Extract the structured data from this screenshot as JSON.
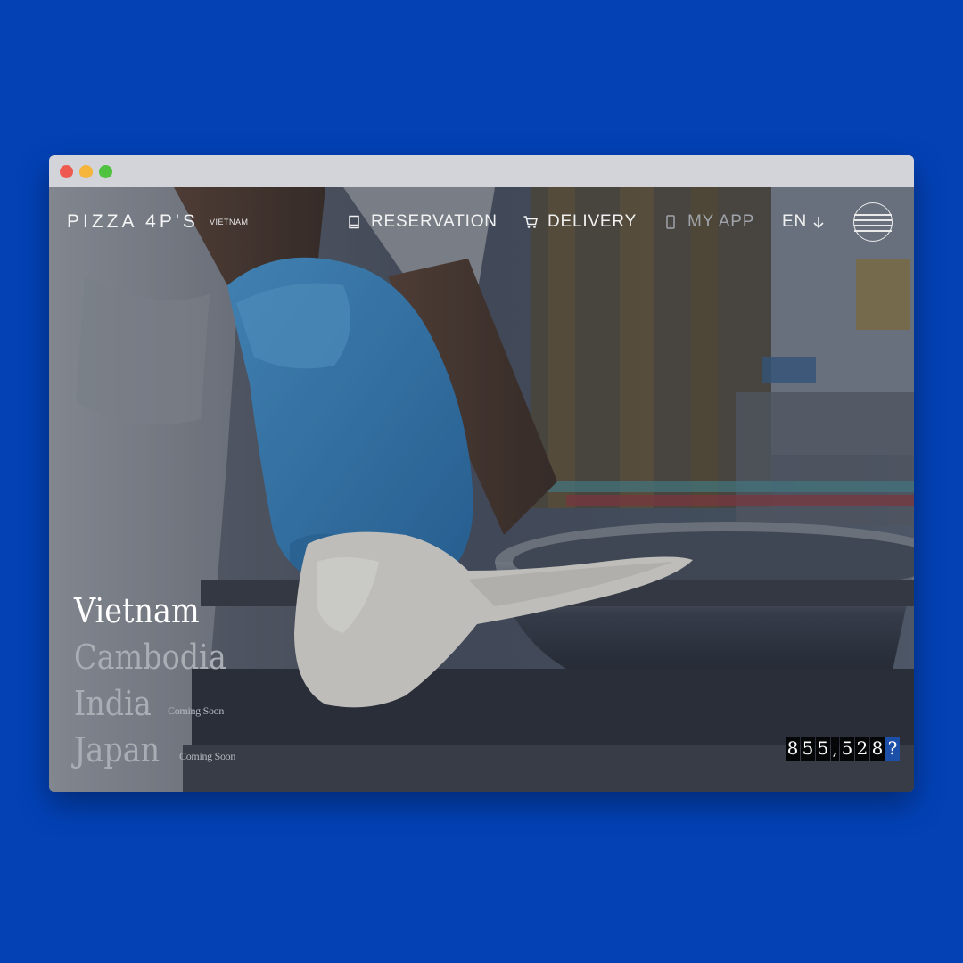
{
  "window": {
    "controls": [
      "close",
      "minimize",
      "maximize"
    ]
  },
  "colors": {
    "background": "#0341b5",
    "titlebar": "#d3d4d9",
    "close": "#ee5a4f",
    "minimize": "#f5b43a",
    "maximize": "#4fc23f",
    "glove": "#3b86c4",
    "counter_digit_bg": "#050607",
    "counter_rolling_bg": "#1b4fa8"
  },
  "header": {
    "logo": "PIZZA 4P'S",
    "logo_sub": "VIETNAM",
    "nav": [
      {
        "label": "RESERVATION",
        "icon": "book-icon"
      },
      {
        "label": "DELIVERY",
        "icon": "cart-icon"
      },
      {
        "label": "MY APP",
        "icon": "phone-icon"
      }
    ],
    "language": {
      "label": "EN",
      "icon": "arrow-down-icon"
    },
    "menu_icon": "hamburger-circle-icon"
  },
  "hero": {
    "image": "hands in blue glove stretching pizza dough over a steel bowl in a kitchen",
    "countries": [
      {
        "name": "Vietnam",
        "active": true,
        "note": ""
      },
      {
        "name": "Cambodia",
        "active": false,
        "note": ""
      },
      {
        "name": "India",
        "active": false,
        "note": "Coming Soon"
      },
      {
        "name": "Japan",
        "active": false,
        "note": "Coming Soon"
      }
    ],
    "counter": {
      "digits": [
        "8",
        "5",
        "5",
        ",",
        "5",
        "2",
        "8",
        "?"
      ]
    }
  }
}
